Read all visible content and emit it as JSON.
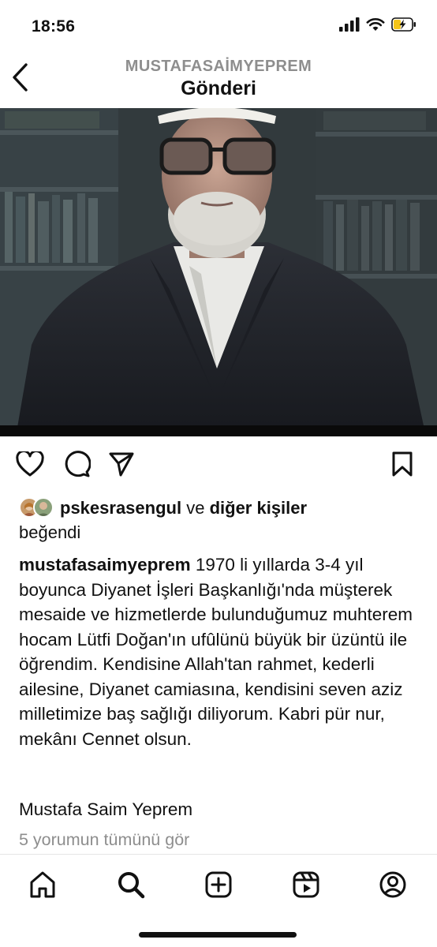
{
  "status_bar": {
    "time": "18:56",
    "icons": [
      "signal-icon",
      "wifi-icon",
      "battery-charging-icon"
    ],
    "battery_color": "#f5c518"
  },
  "header": {
    "username": "MUSTAFASAİMYEPREM",
    "title": "Gönderi",
    "back_icon": "chevron-left-icon"
  },
  "post": {
    "image_icon": "post-photo",
    "actions": [
      "heart-icon",
      "comment-icon",
      "share-icon",
      "bookmark-icon"
    ],
    "likes": {
      "username": "pskesrasengul",
      "connector": "ve",
      "others": "diğer kişiler",
      "suffix": "beğendi"
    },
    "caption": {
      "author": "mustafasaimyeprem",
      "text": "1970 li yıllarda 3-4 yıl boyunca Diyanet İşleri Başkanlığı'nda müşterek mesaide ve hizmetlerde bulunduğumuz muhterem hocam Lütfi Doğan'ın ufûlünü büyük bir üzüntü ile öğrendim. Kendisine Allah'tan rahmet, kederli ailesine, Diyanet camiasına, kendisini seven aziz milletimize baş sağlığı diliyorum. Kabri pür nur, mekânı Cennet olsun.",
      "signature": "Mustafa Saim Yeprem"
    },
    "comments_link": "5 yorumun tümünü gör"
  },
  "bottom_nav": {
    "items": [
      "home-icon",
      "search-icon",
      "create-post-icon",
      "reels-icon",
      "profile-icon"
    ]
  }
}
